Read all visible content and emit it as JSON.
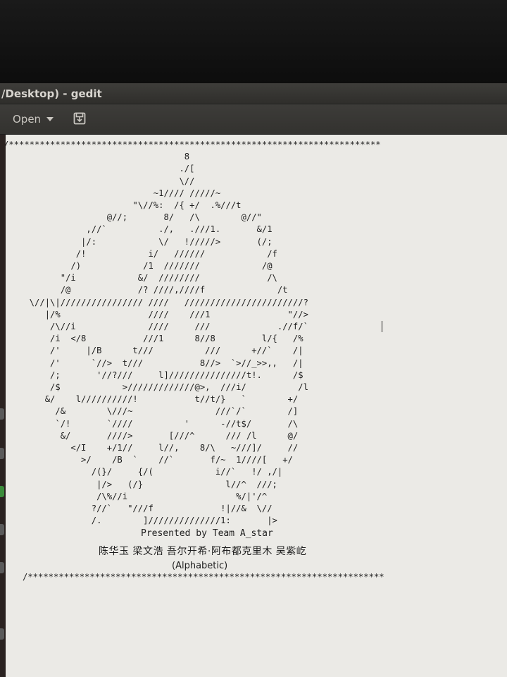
{
  "window": {
    "title": "/Desktop) - gedit"
  },
  "toolbar": {
    "open_label": "Open",
    "open_dropdown_icon": "chevron-down-icon",
    "save_icon": "save-icon"
  },
  "document": {
    "ascii_art": "/************************************************************************\n                                   8\n                                  ./[\n                                  \\//\n                             ~1//// /////~\n                         \"\\//%:  /{ +/  .%///t\n                    @//;       8/   /\\        @//\"\n                ,//`          ./,   .///1.       &/1\n               |/:            \\/   !/////>       (/;\n              /!            i/   //////            /f\n             /)            /1  ///////            /@\n           \"/i            &/  ////////             /\\\n           /@             /? ////,////f              /t\n     \\//|\\|//////////////// ////   ///////////////////////?\n        |/%                 ////    ///1               \"//>\n         /\\//i              ////     ///             .//f/`\n         /i  </8           ///1      8//8         l/{   /%\n         /'     |/B      t///          ///      +//`    /|\n         /'      `//>  t///           8//>  `>//_>>,,   /|\n         /;       '//?///     l]///////////////t!.      /$\n         /$            >/////////////@>,  ///i/          /l\n        &/    l//////////!           t//t/}   `        +/\n          /&        \\///~                ///`/`        /]\n          `/!       `////          '      -//t$/       /\\\n           &/       ////>       [///^      /// /l      @/\n             </I    +/1//     l//,    8/\\   ~///]/     //\n               >/    /B  `    //`       f/~  1////[   +/\n                 /(}/     {/(            i//`   !/ ,/|\n                  |/>   (/}                l//^  ///;\n                  /\\%//i                     %/|'/^\n                 ?//`   \"///f             !|//&  \\//\n                 /.        ]//////////////1:       |>"
  },
  "credits": {
    "presented": "Presented by Team A_star",
    "names": "陈华玉 梁文浩 吾尔开希·阿布都克里木 吴紫屹",
    "alphabetic": "(Alphabetic)",
    "bottom_rule": "/*********************************************************************"
  }
}
